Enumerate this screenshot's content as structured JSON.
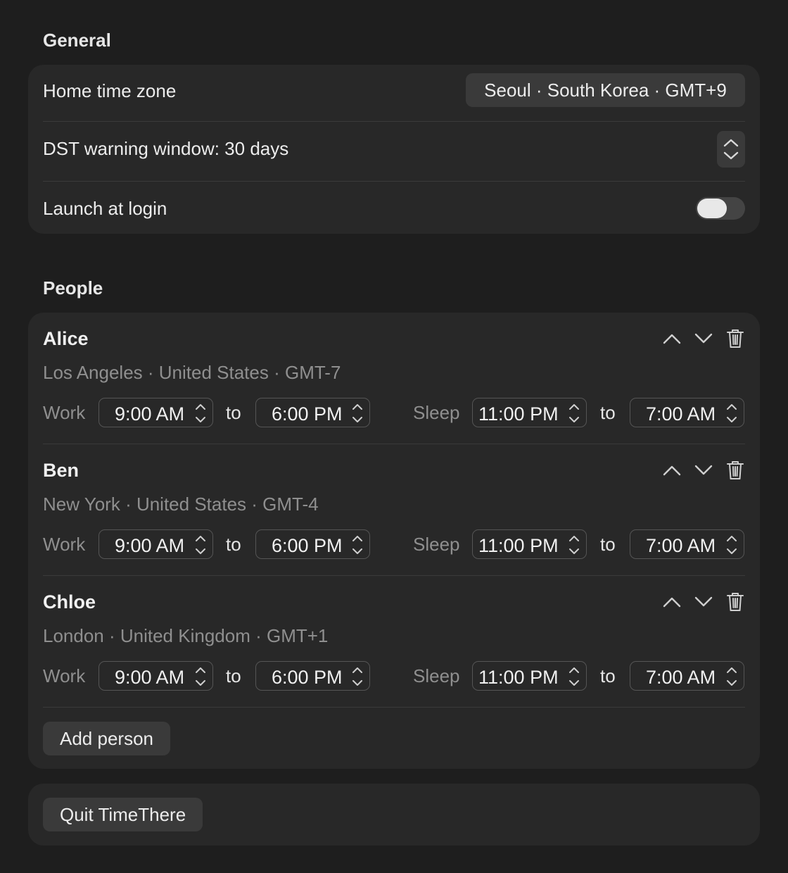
{
  "general": {
    "title": "General",
    "home_tz_label": "Home time zone",
    "home_tz_value": "Seoul · South Korea · GMT+9",
    "dst_label": "DST warning window: 30 days",
    "launch_label": "Launch at login",
    "launch_enabled": false
  },
  "people": {
    "title": "People",
    "work_label": "Work",
    "sleep_label": "Sleep",
    "to_label": "to",
    "list": [
      {
        "name": "Alice",
        "location": "Los Angeles · United States · GMT-7",
        "work_start": "9:00 AM",
        "work_end": "6:00 PM",
        "sleep_start": "11:00 PM",
        "sleep_end": "7:00 AM"
      },
      {
        "name": "Ben",
        "location": "New York · United States · GMT-4",
        "work_start": "9:00 AM",
        "work_end": "6:00 PM",
        "sleep_start": "11:00 PM",
        "sleep_end": "7:00 AM"
      },
      {
        "name": "Chloe",
        "location": "London · United Kingdom · GMT+1",
        "work_start": "9:00 AM",
        "work_end": "6:00 PM",
        "sleep_start": "11:00 PM",
        "sleep_end": "7:00 AM"
      }
    ],
    "add_label": "Add person"
  },
  "quit_label": "Quit TimeThere",
  "icons": {
    "up": "chevron-up-icon",
    "down": "chevron-down-icon",
    "delete": "trash-icon",
    "stepper": "stepper-icon"
  },
  "colors": {
    "background": "#1e1e1e",
    "card": "#282828",
    "control": "#3a3a3a",
    "secondary_text": "#8f8f8f"
  }
}
